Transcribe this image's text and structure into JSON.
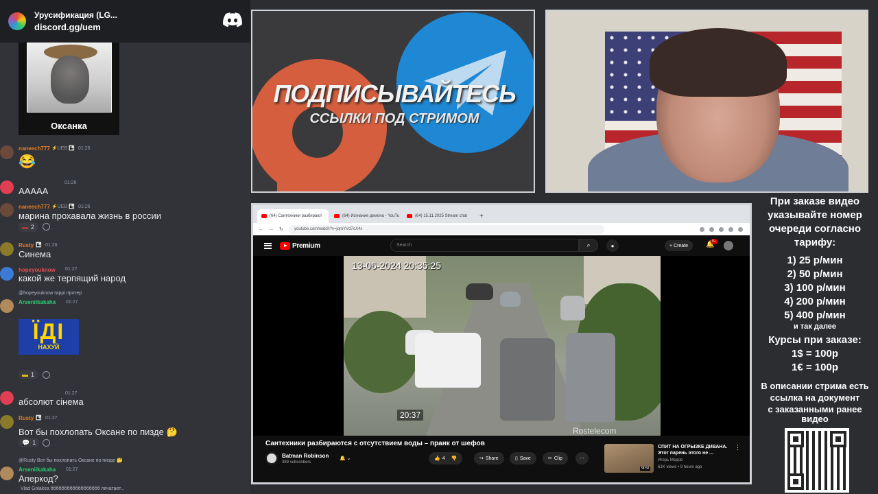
{
  "discord": {
    "server_name": "Урусификация (LG...",
    "invite": "discord.gg/uem",
    "pinned_caption": "Оксанка",
    "messages": [
      {
        "user": "naneech777",
        "tags": "⚡UEB 👨‍👦",
        "time": "01:26",
        "emoji": "😂"
      },
      {
        "user": "",
        "time": "01:26",
        "text": "ААААА"
      },
      {
        "user": "naneech777",
        "tags": "⚡UEB 👨‍👦",
        "time": "01:26",
        "text": "марина прохавала жизнь в россии",
        "react": "2"
      },
      {
        "user": "Rusty",
        "tags": "👨‍👦",
        "time": "01:26",
        "text": "Синема"
      },
      {
        "user": "hopeyouknow",
        "time": "01:27",
        "text": "какой же терпящий народ"
      },
      {
        "reply": "@hopeyouknow гаррі протер",
        "user": "Arseniikakaha",
        "time": "01:27",
        "sticker_big": "ЇДІ",
        "sticker_small": "НАХУЙ",
        "react": "1"
      },
      {
        "user": "",
        "time": "01:27",
        "text": "абсолют сінема"
      },
      {
        "user": "Rusty",
        "tags": "👨‍👦",
        "time": "01:27",
        "text": "Вот бы похлопать Оксане по пизде 🤔",
        "react": "1"
      },
      {
        "reply": "@Rusty Вот бы похлопать Оксане по пизде 🤔",
        "user": "Arseniikakaha",
        "time": "01:27",
        "text": "Аперкод?"
      }
    ],
    "typing": "Vlad Golaksa бббббббббббббббббб печатает..."
  },
  "banner": {
    "title": "ПОДПИСЫВАЙТЕСЬ",
    "subtitle": "ССЫЛКИ ПОД СТРИМОМ"
  },
  "browser": {
    "tabs": [
      {
        "label": "(64) Сантехники разбирают",
        "active": true
      },
      {
        "label": "(64) Изгнание демона - YouTu",
        "active": false
      },
      {
        "label": "(64) 15.11.2025 Stream chat",
        "active": false
      }
    ],
    "url": "youtube.com/watch?v=jqmYVd7oX4s",
    "yt_premium": "Premium",
    "search_placeholder": "Search",
    "create_label": "+ Create",
    "notif_count": "9+",
    "video_timestamp": "13-06-2024 20:35:25",
    "video_counter": "20:37",
    "video_watermark": "Rostelecom",
    "video_title": "Сантехники разбираются с отсутствием воды – пранк от шефов",
    "channel_name": "Batman Robinson",
    "channel_subs": "389 subscribers",
    "likes": "4",
    "share_label": "Share",
    "save_label": "Save",
    "clip_label": "Clip",
    "side_video": {
      "title": "СПИТ НА ОГРЫЗКЕ ДИВАНА. Этот парень этого не ...",
      "channel": "Игорь Мёдов",
      "meta": "61K views • 9 hours ago",
      "duration": "38:58"
    }
  },
  "pricing": {
    "intro": [
      "При заказе видео",
      "указывайте номер",
      "очереди согласно",
      "тарифу:"
    ],
    "tiers": [
      "1) 25 р/мин",
      "2) 50 р/мин",
      "3) 100 р/мин",
      "4) 200 р/мин",
      "5) 400 р/мин"
    ],
    "etc": "и так далее",
    "rates_title": "Курсы при заказе:",
    "rates": [
      "1$ = 100р",
      "1€ = 100р"
    ],
    "outro": [
      "В описании стрима есть",
      "ссылка на документ",
      "с заказанными ранее",
      "видео"
    ]
  }
}
